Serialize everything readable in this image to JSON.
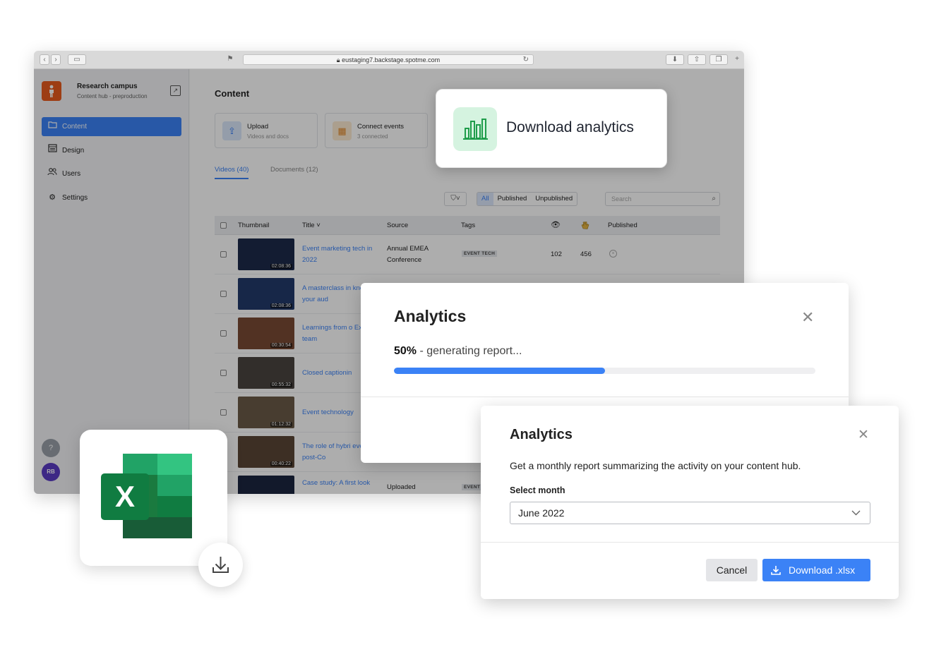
{
  "browser": {
    "url": "eustaging7.backstage.spotme.com"
  },
  "sidebar": {
    "hub_name": "Research campus",
    "hub_subtitle": "Content hub - preproduction",
    "items": [
      {
        "label": "Content",
        "icon": "folder-icon",
        "active": true
      },
      {
        "label": "Design",
        "icon": "layout-icon",
        "active": false
      },
      {
        "label": "Users",
        "icon": "users-icon",
        "active": false
      },
      {
        "label": "Settings",
        "icon": "gear-icon",
        "active": false
      }
    ],
    "avatar_initials": "RB"
  },
  "main": {
    "title": "Content",
    "actions": [
      {
        "title": "Upload",
        "subtitle": "Videos and docs",
        "icon": "upload-icon",
        "color": "#dbe7fb"
      },
      {
        "title": "Connect events",
        "subtitle": "3 connected",
        "icon": "calendar-icon",
        "color": "#fdebd2"
      }
    ],
    "tabs": [
      {
        "label": "Videos (40)",
        "active": true
      },
      {
        "label": "Documents (12)",
        "active": false
      }
    ],
    "filters": [
      "All",
      "Published",
      "Unpublished"
    ],
    "search_placeholder": "Search",
    "columns": [
      "Thumbnail",
      "Title ˅",
      "Source",
      "Tags",
      "Published"
    ],
    "rows": [
      {
        "duration": "02:08:36",
        "title": "Event marketing tech in 2022",
        "source_line1": "Annual EMEA",
        "source_line2": "Conference",
        "tag": "EVENT TECH",
        "views": "102",
        "claps": "456",
        "thumb": "#1d2a4a"
      },
      {
        "duration": "02:08:36",
        "title": "A masterclass in knowing your aud",
        "thumb": "#223a6b"
      },
      {
        "duration": "00:30:54",
        "title": "Learnings from o Exec team",
        "thumb": "#7a4a34"
      },
      {
        "duration": "00:55:32",
        "title": "Closed captionin",
        "thumb": "#4a4540"
      },
      {
        "duration": "01:12:32",
        "title": "Event technology",
        "thumb": "#6b5a48"
      },
      {
        "duration": "00:40:22",
        "title": "The role of hybri events in post-Co",
        "thumb": "#5a4636"
      },
      {
        "duration": "",
        "title": "Case study: A first look",
        "source_line1": "Uploaded",
        "tag": "EVENT",
        "thumb": "#1b2540"
      }
    ]
  },
  "download_card": {
    "label": "Download analytics",
    "accent": "#1f9d4b"
  },
  "progress_modal": {
    "title": "Analytics",
    "percent_label": "50%",
    "status_text": " - generating report...",
    "progress": 0.5
  },
  "report_modal": {
    "title": "Analytics",
    "description": "Get a monthly report summarizing the activity on your content hub.",
    "select_label": "Select month",
    "selected_month": "June 2022",
    "cancel_label": "Cancel",
    "download_label": "Download .xlsx"
  },
  "colors": {
    "primary": "#3b82f6",
    "brand_orange": "#e85a1e",
    "excel_green": "#1a7a3f"
  }
}
